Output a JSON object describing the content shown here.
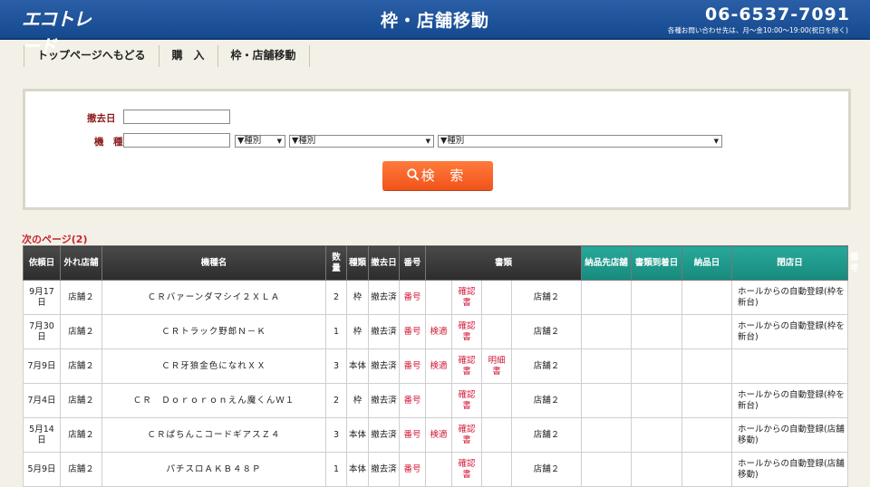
{
  "header": {
    "logo": "エコトレード",
    "title": "枠・店舗移動",
    "phone": "06-6537-7091",
    "hours": "各種お問い合わせ先は、月～金10:00～19:00(祝日を除く)"
  },
  "nav": [
    "トップページへもどる",
    "購　入",
    "枠・店舗移動"
  ],
  "search": {
    "date_label": "撤去日",
    "model_label": "機　種",
    "date_value": "",
    "model_value": "",
    "select1": "▼種別",
    "select2": "▼種別",
    "select3": "▼種別",
    "button_label": "検 索"
  },
  "next_page": "次のページ(2)",
  "table": {
    "headers": [
      "依頼日",
      "外れ店舗",
      "機種名",
      "数量",
      "種類",
      "撤去日",
      "番号",
      "書類",
      "納品先店舗",
      "書類到着日",
      "納品日",
      "閉店日",
      "備考"
    ],
    "rows": [
      [
        "9月17日",
        "店舗２",
        "ＣＲバァーンダマシイ２ＸＬＡ",
        "2",
        "枠",
        "撤去済",
        "番号",
        "",
        "確認書",
        "",
        "店舗２",
        "",
        "",
        "",
        "ホールからの自動登録(枠を新台)"
      ],
      [
        "7月30日",
        "店舗２",
        "ＣＲトラック野郎Ｎ－Ｋ",
        "1",
        "枠",
        "撤去済",
        "番号",
        "検適",
        "確認書",
        "",
        "店舗２",
        "",
        "",
        "",
        "ホールからの自動登録(枠を新台)"
      ],
      [
        "7月9日",
        "店舗２",
        "ＣＲ牙狼金色になれＸＸ",
        "3",
        "本体",
        "撤去済",
        "番号",
        "検適",
        "確認書",
        "明細書",
        "店舗２",
        "",
        "",
        "",
        ""
      ],
      [
        "7月4日",
        "店舗２",
        "ＣＲ　Ｄｏｒｏｒｏｎえん魔くんＷ１",
        "2",
        "枠",
        "撤去済",
        "番号",
        "",
        "確認書",
        "",
        "店舗２",
        "",
        "",
        "",
        "ホールからの自動登録(枠を新台)"
      ],
      [
        "5月14日",
        "店舗２",
        "ＣＲぱちんこコードギアスＺ４",
        "3",
        "本体",
        "撤去済",
        "番号",
        "検適",
        "確認書",
        "",
        "店舗２",
        "",
        "",
        "",
        "ホールからの自動登録(店舗移動)"
      ],
      [
        "5月9日",
        "店舗２",
        "パチスロＡＫＢ４８Ｐ",
        "1",
        "本体",
        "撤去済",
        "番号",
        "",
        "確認書",
        "",
        "店舗２",
        "",
        "",
        "",
        "ホールからの自動登録(店舗移動)"
      ]
    ]
  },
  "colors": {
    "header_blue": "#1e54a0",
    "accent_orange": "#f5621f",
    "teal": "#1f9a8c",
    "link_red": "#d21a3a"
  }
}
